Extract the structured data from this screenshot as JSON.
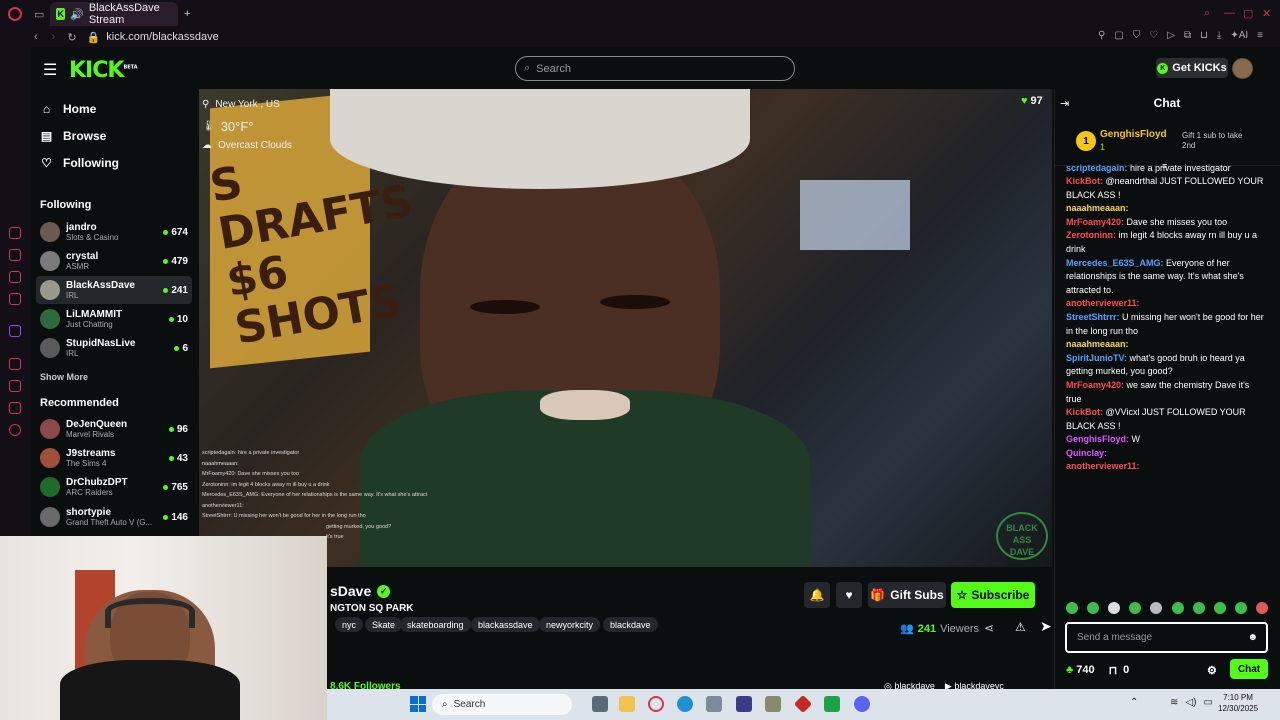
{
  "browser": {
    "tab_title": "BlackAssDave Stream",
    "url": "kick.com/blackassdave"
  },
  "header": {
    "logo": "KICK",
    "logo_beta": "BETA",
    "search_placeholder": "Search",
    "get_kicks": "Get KICKs"
  },
  "nav": {
    "home": "Home",
    "browse": "Browse",
    "following": "Following"
  },
  "following": {
    "heading": "Following",
    "channels": [
      {
        "name": "jandro",
        "category": "Slots & Casino",
        "viewers": "674"
      },
      {
        "name": "crystal",
        "category": "ASMR",
        "viewers": "479"
      },
      {
        "name": "BlackAssDave",
        "category": "IRL",
        "viewers": "241"
      },
      {
        "name": "LiLMAMMIT",
        "category": "Just Chatting",
        "viewers": "10"
      },
      {
        "name": "StupidNasLive",
        "category": "IRL",
        "viewers": "6"
      }
    ],
    "show_more": "Show More"
  },
  "recommended": {
    "heading": "Recommended",
    "channels": [
      {
        "name": "DeJenQueen",
        "category": "Marvel Rivals",
        "viewers": "96"
      },
      {
        "name": "J9streams",
        "category": "The Sims 4",
        "viewers": "43"
      },
      {
        "name": "DrChubzDPT",
        "category": "ARC Raiders",
        "viewers": "765"
      },
      {
        "name": "shortypie",
        "category": "Grand Theft Auto V (G...",
        "viewers": "146"
      }
    ]
  },
  "video": {
    "location": "New York , US",
    "temperature": "30°F°",
    "weather": "Overcast Clouds",
    "viewer_badge": "97",
    "sign_text": "S DRAFTS $6 SHOTS",
    "overlay_chat": [
      "scriptedagain: hire a private investigator",
      "naaahmeaaan:",
      "MrFoamy420: Dave she misses you too",
      "Zerotoninn: im legit 4 blocks away rn ill buy u a drink",
      "Mercedes_E63S_AMG: Everyone of her relationships is the same way. It's what she's attract",
      "anotherviewer11:",
      "StreetShtrrr: U missing her won't be good for her in the long run tho",
      "getting murked, you good?",
      "it's true"
    ]
  },
  "stream": {
    "channel_name": "sDave",
    "title": "NGTON SQ PARK",
    "tags": [
      "nyc",
      "Skate",
      "skateboarding",
      "blackassdave",
      "newyorkcity",
      "blackdave"
    ],
    "gift_subs": "Gift Subs",
    "subscribe": "Subscribe",
    "viewers": "241",
    "viewers_label": "Viewers",
    "followers_partial": "8.6K Followers",
    "socials": [
      "blackdave",
      "blackdaveyc"
    ]
  },
  "chat": {
    "title": "Chat",
    "pinned_user": "GenghisFloyd",
    "pinned_count": "1",
    "pinned_text": "Gift 1 sub to take 2nd",
    "messages": [
      {
        "user": "scriptedagain:",
        "text": "hire a private investigator",
        "color": "#4fa3ff"
      },
      {
        "user": "KickBot:",
        "text": "@neandrthal JUST FOLLOWED YOUR BLACK ASS !",
        "color": "#ff4d4d"
      },
      {
        "user": "naaahmeaaan:",
        "text": "",
        "color": "#ffd54a"
      },
      {
        "user": "MrFoamy420:",
        "text": "Dave she misses you too",
        "color": "#ff4d4d"
      },
      {
        "user": "Zerotoninn:",
        "text": "im legit 4 blocks away rn ill buy u a drink",
        "color": "#ff4d4d"
      },
      {
        "user": "Mercedes_E63S_AMG:",
        "text": "Everyone of her relationships is the same way. It's what she's attracted to.",
        "color": "#4fa3ff"
      },
      {
        "user": "anotherviewer11:",
        "text": "",
        "color": "#ff4d4d"
      },
      {
        "user": "StreetShtrrr:",
        "text": "U missing her won't be good for her in the long run tho",
        "color": "#4fa3ff"
      },
      {
        "user": "naaahmeaaan:",
        "text": "",
        "color": "#ffd54a"
      },
      {
        "user": "SpiritJunioTV:",
        "text": "what's good bruh io heard ya getting murked, you good?",
        "color": "#4fa3ff"
      },
      {
        "user": "MrFoamy420:",
        "text": "we saw the chemistry Dave it's true",
        "color": "#ff4d4d"
      },
      {
        "user": "KickBot:",
        "text": "@VVicxl JUST FOLLOWED YOUR BLACK ASS !",
        "color": "#ff4d4d"
      },
      {
        "user": "GenghisFloyd:",
        "text": "W",
        "color": "#e055ff"
      },
      {
        "user": "Quinclay:",
        "text": "",
        "color": "#e055ff"
      },
      {
        "user": "anotherviewer11:",
        "text": "",
        "color": "#ff4d4d"
      }
    ],
    "input_placeholder": "Send a message",
    "points": "740",
    "gifts": "0",
    "send": "Chat"
  },
  "taskbar": {
    "search": "Search",
    "time": "7:10 PM",
    "date": "12/30/2025"
  },
  "colors": {
    "brand": "#53fc18",
    "background": "#0b0e0f"
  }
}
